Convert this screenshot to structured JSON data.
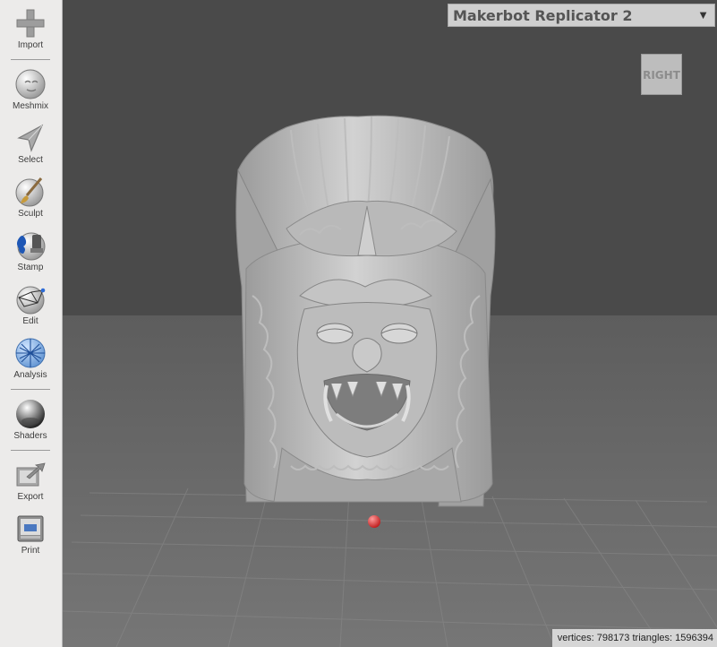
{
  "toolbar": {
    "items": [
      {
        "label": "Import",
        "icon": "plus-icon"
      },
      {
        "label": "Meshmix",
        "icon": "sphere-face-icon"
      },
      {
        "label": "Select",
        "icon": "arrow-cursor-icon"
      },
      {
        "label": "Sculpt",
        "icon": "brush-icon"
      },
      {
        "label": "Stamp",
        "icon": "stamp-icon"
      },
      {
        "label": "Edit",
        "icon": "mesh-edit-icon"
      },
      {
        "label": "Analysis",
        "icon": "analysis-sphere-icon"
      },
      {
        "label": "Shaders",
        "icon": "chrome-sphere-icon"
      },
      {
        "label": "Export",
        "icon": "export-icon"
      },
      {
        "label": "Print",
        "icon": "printer-icon"
      }
    ]
  },
  "printer": {
    "selected": "Makerbot Replicator 2"
  },
  "viewcube": {
    "face": "RIGHT"
  },
  "status": {
    "text": "vertices: 798173 triangles: 1596394"
  },
  "colors": {
    "panel": "#ecebea",
    "backdrop": "#4a4a4a",
    "floor": "#6a6a6a",
    "model": "#b4b4b4",
    "pivot": "#d62a2a"
  }
}
